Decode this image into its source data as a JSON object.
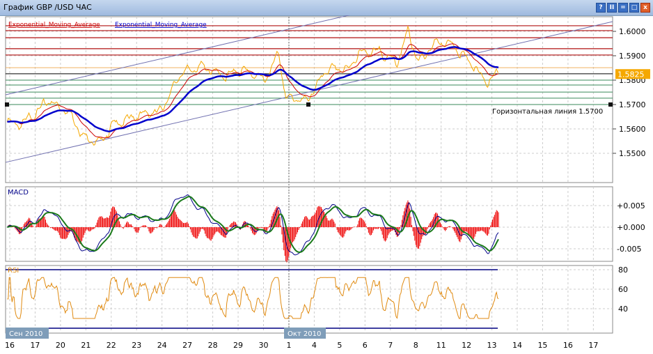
{
  "window": {
    "title": "График GBP /USD  ЧАС",
    "buttons": [
      "?",
      "II",
      "=",
      "□",
      "x"
    ]
  },
  "colors": {
    "price": "#f5a800",
    "ema_fast": "#cc0000",
    "ema_slow": "#0000cc",
    "macd": "#000088",
    "signal": "#1a7a1a",
    "hist": "#ee0000",
    "rsi": "#e08a10",
    "current_price_bg": "#f5a800"
  },
  "chart_data": [
    {
      "type": "line",
      "title": "GBP /USD",
      "legend": [
        "Exponential_Moving_Average",
        "Exponential_Moving_Average"
      ],
      "yticks": [
        "1.6000",
        "1.5900",
        "1.5800",
        "1.5700",
        "1.5600",
        "1.5500"
      ],
      "ylim": [
        1.544,
        1.605
      ],
      "current_price": "1.5825",
      "price_waypoints": [
        [
          -0.1,
          1.5629
        ],
        [
          0.44,
          1.5614
        ],
        [
          1.54,
          1.5714
        ],
        [
          2.36,
          1.5671
        ],
        [
          2.91,
          1.5571
        ],
        [
          3.6,
          1.5543
        ],
        [
          4.01,
          1.5614
        ],
        [
          5.11,
          1.5657
        ],
        [
          5.93,
          1.5671
        ],
        [
          6.76,
          1.5829
        ],
        [
          7.58,
          1.5857
        ],
        [
          8.41,
          1.5814
        ],
        [
          9.23,
          1.5843
        ],
        [
          10.05,
          1.58
        ],
        [
          10.6,
          1.5914
        ],
        [
          10.88,
          1.5729
        ],
        [
          11.7,
          1.5714
        ],
        [
          12.53,
          1.5843
        ],
        [
          13.35,
          1.5843
        ],
        [
          13.76,
          1.5914
        ],
        [
          14.59,
          1.5914
        ],
        [
          15.27,
          1.5871
        ],
        [
          15.69,
          1.6
        ],
        [
          16.1,
          1.5871
        ],
        [
          16.79,
          1.5957
        ],
        [
          17.47,
          1.5943
        ],
        [
          18.02,
          1.5886
        ],
        [
          18.57,
          1.5814
        ],
        [
          18.85,
          1.5786
        ],
        [
          19.26,
          1.5829
        ]
      ],
      "hlines_red": [
        1.6023,
        1.6003,
        1.5974,
        1.5929,
        1.5903
      ],
      "hline_orange": 1.5851,
      "hline_black": 1.5826,
      "hlines_green": [
        1.58,
        1.578,
        1.5751,
        1.5726,
        1.57
      ],
      "horizontal_line_label": "Горизонтальная линия 1.5700",
      "channel": {
        "start": [
          -0.16,
          1.574
        ],
        "end": [
          14.6,
          1.6096
        ],
        "offset": -0.0277
      }
    },
    {
      "type": "line",
      "title": "MACD",
      "yticks": [
        "+0.005",
        "+0.000",
        "-0.005"
      ],
      "ylim": [
        -0.0085,
        0.0085
      ]
    },
    {
      "type": "line",
      "title": "RSI",
      "yticks": [
        "80",
        "60",
        "40"
      ],
      "levels": [
        80,
        20
      ],
      "ylim": [
        18,
        82
      ]
    }
  ],
  "xaxis": {
    "ticks": [
      "16",
      "17",
      "20",
      "21",
      "22",
      "23",
      "24",
      "27",
      "28",
      "29",
      "30",
      "1",
      "4",
      "5",
      "6",
      "7",
      "8",
      "11",
      "12",
      "13",
      "14",
      "15",
      "16",
      "17"
    ],
    "months": [
      "Сен 2010",
      "Окт 2010"
    ]
  }
}
